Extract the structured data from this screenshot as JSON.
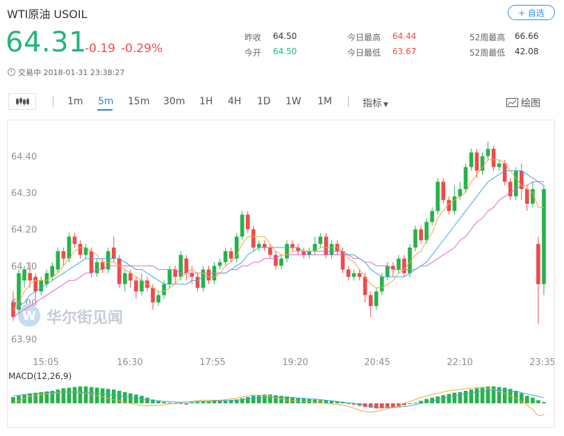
{
  "header": {
    "title": "WTI原油  USOIL",
    "add_button": "+ 自选",
    "price": "64.31",
    "change": "-0.19",
    "change_pct": "-0.29%",
    "status": "交易中 2018-01-31 23:38:27"
  },
  "stats": [
    {
      "label": "昨收",
      "value": "64.50",
      "color": "#333333"
    },
    {
      "label": "今开",
      "value": "64.50",
      "color": "#21b67a"
    },
    {
      "label": "今日最高",
      "value": "64.44",
      "color": "#f04a4a"
    },
    {
      "label": "今日最低",
      "value": "63.67",
      "color": "#f04a4a"
    },
    {
      "label": "52周最高",
      "value": "66.66",
      "color": "#333333"
    },
    {
      "label": "52周最低",
      "value": "42.08",
      "color": "#333333"
    }
  ],
  "toolbar": {
    "intervals": [
      "1m",
      "5m",
      "15m",
      "30m",
      "1H",
      "4H",
      "1D",
      "1W",
      "1M"
    ],
    "active": "5m",
    "indicators": "指标",
    "draw": "绘图"
  },
  "watermark": "华尔街见闻",
  "colors": {
    "up": "#26b34a",
    "down": "#f04a4a",
    "accent": "#2f7fd8",
    "ma5": "#f0a53c",
    "ma10": "#3aa7e0",
    "ma20": "#e063d8"
  },
  "chart_data": {
    "type": "candlestick",
    "y_ticks": [
      "64.40",
      "64.30",
      "64.20",
      "64.10",
      "64.00",
      "63.90"
    ],
    "ylim": [
      63.88,
      64.46
    ],
    "x_labels": [
      "15:05",
      "16:30",
      "17:55",
      "19:20",
      "20:45",
      "22:10",
      "23:35"
    ],
    "macd_label": "MACD(12,26,9)",
    "candles": [
      [
        64.0,
        63.96,
        64.03,
        63.95
      ],
      [
        63.98,
        64.08,
        64.09,
        63.97
      ],
      [
        64.06,
        64.09,
        64.1,
        64.04
      ],
      [
        64.08,
        64.06,
        64.11,
        64.04
      ],
      [
        64.07,
        64.03,
        64.08,
        64.01
      ],
      [
        64.03,
        64.06,
        64.07,
        64.02
      ],
      [
        64.05,
        64.08,
        64.09,
        64.04
      ],
      [
        64.07,
        64.1,
        64.11,
        64.06
      ],
      [
        64.09,
        64.14,
        64.15,
        64.08
      ],
      [
        64.14,
        64.12,
        64.15,
        64.1
      ],
      [
        64.12,
        64.18,
        64.19,
        64.11
      ],
      [
        64.18,
        64.16,
        64.19,
        64.15
      ],
      [
        64.16,
        64.13,
        64.17,
        64.12
      ],
      [
        64.13,
        64.15,
        64.16,
        64.12
      ],
      [
        64.14,
        64.08,
        64.15,
        64.07
      ],
      [
        64.08,
        64.11,
        64.12,
        64.07
      ],
      [
        64.11,
        64.09,
        64.12,
        64.08
      ],
      [
        64.09,
        64.14,
        64.15,
        64.08
      ],
      [
        64.15,
        64.12,
        64.18,
        64.11
      ],
      [
        64.12,
        64.05,
        64.13,
        64.04
      ],
      [
        64.05,
        64.08,
        64.09,
        64.03
      ],
      [
        64.08,
        64.06,
        64.09,
        64.04
      ],
      [
        64.06,
        64.03,
        64.07,
        64.01
      ],
      [
        64.03,
        64.06,
        64.08,
        64.02
      ],
      [
        64.06,
        64.04,
        64.07,
        64.03
      ],
      [
        64.04,
        64.0,
        64.05,
        63.98
      ],
      [
        64.0,
        64.02,
        64.03,
        63.99
      ],
      [
        64.02,
        64.05,
        64.06,
        64.01
      ],
      [
        64.05,
        64.09,
        64.1,
        64.04
      ],
      [
        64.09,
        64.07,
        64.1,
        64.05
      ],
      [
        64.07,
        64.13,
        64.14,
        64.06
      ],
      [
        64.12,
        64.08,
        64.13,
        64.06
      ],
      [
        64.08,
        64.07,
        64.1,
        64.05
      ],
      [
        64.07,
        64.04,
        64.08,
        64.03
      ],
      [
        64.04,
        64.09,
        64.1,
        64.03
      ],
      [
        64.09,
        64.06,
        64.1,
        64.05
      ],
      [
        64.06,
        64.1,
        64.11,
        64.05
      ],
      [
        64.1,
        64.11,
        64.12,
        64.09
      ],
      [
        64.11,
        64.14,
        64.15,
        64.1
      ],
      [
        64.14,
        64.12,
        64.15,
        64.11
      ],
      [
        64.12,
        64.18,
        64.19,
        64.11
      ],
      [
        64.18,
        64.24,
        64.25,
        64.17
      ],
      [
        64.24,
        64.2,
        64.25,
        64.19
      ],
      [
        64.2,
        64.15,
        64.21,
        64.14
      ],
      [
        64.15,
        64.16,
        64.17,
        64.14
      ],
      [
        64.16,
        64.15,
        64.17,
        64.14
      ],
      [
        64.15,
        64.13,
        64.16,
        64.12
      ],
      [
        64.13,
        64.1,
        64.14,
        64.09
      ],
      [
        64.1,
        64.12,
        64.13,
        64.09
      ],
      [
        64.12,
        64.16,
        64.17,
        64.11
      ],
      [
        64.16,
        64.15,
        64.17,
        64.14
      ],
      [
        64.15,
        64.14,
        64.16,
        64.13
      ],
      [
        64.14,
        64.13,
        64.15,
        64.12
      ],
      [
        64.13,
        64.14,
        64.15,
        64.12
      ],
      [
        64.14,
        64.16,
        64.18,
        64.13
      ],
      [
        64.16,
        64.18,
        64.19,
        64.15
      ],
      [
        64.18,
        64.13,
        64.19,
        64.12
      ],
      [
        64.13,
        64.16,
        64.17,
        64.12
      ],
      [
        64.16,
        64.14,
        64.17,
        64.13
      ],
      [
        64.14,
        64.09,
        64.15,
        64.08
      ],
      [
        64.09,
        64.07,
        64.1,
        64.06
      ],
      [
        64.07,
        64.08,
        64.09,
        64.06
      ],
      [
        64.08,
        64.07,
        64.09,
        64.06
      ],
      [
        64.07,
        64.02,
        64.08,
        64.0
      ],
      [
        64.02,
        63.99,
        64.03,
        63.96
      ],
      [
        63.99,
        64.03,
        64.04,
        63.98
      ],
      [
        64.03,
        64.07,
        64.08,
        64.02
      ],
      [
        64.07,
        64.1,
        64.11,
        64.06
      ],
      [
        64.1,
        64.09,
        64.11,
        64.07
      ],
      [
        64.09,
        64.12,
        64.13,
        64.08
      ],
      [
        64.12,
        64.08,
        64.13,
        64.07
      ],
      [
        64.08,
        64.15,
        64.16,
        64.07
      ],
      [
        64.15,
        64.2,
        64.21,
        64.14
      ],
      [
        64.2,
        64.17,
        64.21,
        64.16
      ],
      [
        64.17,
        64.22,
        64.23,
        64.16
      ],
      [
        64.22,
        64.25,
        64.26,
        64.21
      ],
      [
        64.25,
        64.33,
        64.34,
        64.24
      ],
      [
        64.33,
        64.28,
        64.34,
        64.27
      ],
      [
        64.28,
        64.25,
        64.29,
        64.24
      ],
      [
        64.25,
        64.29,
        64.32,
        64.24
      ],
      [
        64.29,
        64.31,
        64.33,
        64.28
      ],
      [
        64.31,
        64.37,
        64.38,
        64.3
      ],
      [
        64.37,
        64.41,
        64.42,
        64.36
      ],
      [
        64.41,
        64.36,
        64.42,
        64.34
      ],
      [
        64.36,
        64.4,
        64.41,
        64.35
      ],
      [
        64.4,
        64.42,
        64.44,
        64.39
      ],
      [
        64.42,
        64.37,
        64.43,
        64.36
      ],
      [
        64.37,
        64.38,
        64.39,
        64.36
      ],
      [
        64.38,
        64.33,
        64.39,
        64.32
      ],
      [
        64.33,
        64.29,
        64.34,
        64.28
      ],
      [
        64.29,
        64.36,
        64.37,
        64.28
      ],
      [
        64.36,
        64.31,
        64.38,
        64.28
      ],
      [
        64.31,
        64.27,
        64.32,
        64.25
      ],
      [
        64.27,
        64.31,
        64.33,
        64.26
      ],
      [
        64.16,
        64.05,
        64.18,
        63.94
      ],
      [
        64.05,
        64.31,
        64.32,
        64.02
      ]
    ],
    "ma5": [
      63.98,
      64.0,
      64.03,
      64.05,
      64.06,
      64.06,
      64.06,
      64.07,
      64.08,
      64.1,
      64.12,
      64.14,
      64.15,
      64.15,
      64.14,
      64.13,
      64.11,
      64.11,
      64.11,
      64.1,
      64.09,
      64.08,
      64.07,
      64.06,
      64.05,
      64.04,
      64.03,
      64.03,
      64.04,
      64.05,
      64.07,
      64.08,
      64.09,
      64.08,
      64.08,
      64.07,
      64.07,
      64.08,
      64.1,
      64.11,
      64.13,
      64.16,
      64.18,
      64.18,
      64.18,
      64.18,
      64.16,
      64.14,
      64.13,
      64.13,
      64.14,
      64.14,
      64.14,
      64.14,
      64.14,
      64.15,
      64.15,
      64.15,
      64.15,
      64.14,
      64.12,
      64.11,
      64.09,
      64.07,
      64.05,
      64.04,
      64.04,
      64.05,
      64.06,
      64.08,
      64.09,
      64.11,
      64.13,
      64.14,
      64.17,
      64.19,
      64.23,
      64.25,
      64.27,
      64.28,
      64.29,
      64.3,
      64.33,
      64.35,
      64.37,
      64.39,
      64.39,
      64.39,
      64.38,
      64.36,
      64.34,
      64.32,
      64.31,
      64.3,
      64.26,
      64.26
    ],
    "ma10": [
      63.98,
      63.99,
      64.0,
      64.02,
      64.03,
      64.04,
      64.05,
      64.06,
      64.07,
      64.08,
      64.09,
      64.1,
      64.11,
      64.12,
      64.12,
      64.12,
      64.12,
      64.12,
      64.12,
      64.12,
      64.11,
      64.1,
      64.09,
      64.09,
      64.08,
      64.07,
      64.06,
      64.05,
      64.05,
      64.05,
      64.05,
      64.05,
      64.06,
      64.06,
      64.07,
      64.07,
      64.07,
      64.08,
      64.08,
      64.09,
      64.1,
      64.11,
      64.13,
      64.14,
      64.15,
      64.15,
      64.15,
      64.15,
      64.15,
      64.15,
      64.15,
      64.15,
      64.14,
      64.14,
      64.14,
      64.14,
      64.14,
      64.14,
      64.14,
      64.14,
      64.13,
      64.13,
      64.12,
      64.11,
      64.09,
      64.08,
      64.07,
      64.07,
      64.07,
      64.07,
      64.07,
      64.08,
      64.09,
      64.1,
      64.11,
      64.13,
      64.15,
      64.17,
      64.19,
      64.21,
      64.23,
      64.25,
      64.27,
      64.29,
      64.31,
      64.33,
      64.34,
      64.35,
      64.36,
      64.36,
      64.36,
      64.36,
      64.35,
      64.34,
      64.33,
      64.32
    ],
    "ma20": [
      63.96,
      63.97,
      63.98,
      63.99,
      64.0,
      64.01,
      64.02,
      64.03,
      64.04,
      64.05,
      64.06,
      64.06,
      64.07,
      64.08,
      64.08,
      64.09,
      64.09,
      64.1,
      64.1,
      64.1,
      64.1,
      64.1,
      64.1,
      64.1,
      64.1,
      64.1,
      64.09,
      64.09,
      64.09,
      64.09,
      64.08,
      64.08,
      64.08,
      64.08,
      64.08,
      64.08,
      64.08,
      64.08,
      64.08,
      64.09,
      64.09,
      64.1,
      64.1,
      64.11,
      64.11,
      64.12,
      64.12,
      64.12,
      64.13,
      64.13,
      64.13,
      64.13,
      64.13,
      64.13,
      64.13,
      64.13,
      64.13,
      64.13,
      64.13,
      64.13,
      64.13,
      64.12,
      64.12,
      64.11,
      64.11,
      64.1,
      64.1,
      64.1,
      64.09,
      64.09,
      64.09,
      64.09,
      64.09,
      64.1,
      64.1,
      64.11,
      64.12,
      64.13,
      64.14,
      64.15,
      64.17,
      64.18,
      64.2,
      64.22,
      64.23,
      64.25,
      64.26,
      64.28,
      64.29,
      64.3,
      64.31,
      64.32,
      64.32,
      64.33,
      64.33,
      64.33
    ],
    "macd_hist": [
      0.01,
      0.012,
      0.014,
      0.016,
      0.017,
      0.018,
      0.019,
      0.02,
      0.022,
      0.024,
      0.025,
      0.026,
      0.027,
      0.027,
      0.026,
      0.025,
      0.024,
      0.023,
      0.022,
      0.02,
      0.018,
      0.016,
      0.014,
      0.012,
      0.009,
      0.006,
      0.004,
      0.002,
      0.001,
      0.0,
      -0.001,
      -0.002,
      0.001,
      0.002,
      0.003,
      0.003,
      0.004,
      0.004,
      0.005,
      0.005,
      0.006,
      0.008,
      0.01,
      0.012,
      0.013,
      0.014,
      0.014,
      0.013,
      0.012,
      0.011,
      0.01,
      0.009,
      0.008,
      0.007,
      0.006,
      0.005,
      0.005,
      0.004,
      0.003,
      0.002,
      0.0,
      -0.002,
      -0.004,
      -0.006,
      -0.007,
      -0.008,
      -0.008,
      -0.007,
      -0.006,
      -0.005,
      -0.003,
      -0.001,
      0.001,
      0.004,
      0.007,
      0.009,
      0.011,
      0.013,
      0.015,
      0.017,
      0.018,
      0.02,
      0.022,
      0.024,
      0.026,
      0.027,
      0.027,
      0.026,
      0.025,
      0.023,
      0.02,
      0.016,
      0.012,
      0.009,
      0.005,
      0.002
    ],
    "macd_dif": [
      0.0,
      0.004,
      0.008,
      0.011,
      0.013,
      0.014,
      0.015,
      0.016,
      0.017,
      0.018,
      0.018,
      0.018,
      0.017,
      0.016,
      0.014,
      0.012,
      0.01,
      0.008,
      0.006,
      0.004,
      0.002,
      0.0,
      -0.002,
      -0.003,
      -0.004,
      -0.004,
      -0.003,
      -0.002,
      -0.001,
      0.0,
      0.001,
      0.002,
      0.003,
      0.004,
      0.005,
      0.005,
      0.005,
      0.005,
      0.006,
      0.007,
      0.008,
      0.01,
      0.012,
      0.013,
      0.013,
      0.012,
      0.011,
      0.009,
      0.007,
      0.005,
      0.004,
      0.003,
      0.003,
      0.003,
      0.002,
      0.001,
      0.0,
      -0.001,
      -0.002,
      -0.003,
      -0.005,
      -0.008,
      -0.011,
      -0.013,
      -0.014,
      -0.013,
      -0.011,
      -0.009,
      -0.006,
      -0.003,
      0.0,
      0.003,
      0.006,
      0.009,
      0.012,
      0.014,
      0.016,
      0.018,
      0.02,
      0.021,
      0.022,
      0.023,
      0.024,
      0.025,
      0.025,
      0.024,
      0.022,
      0.019,
      0.016,
      0.012,
      0.008,
      0.003,
      -0.003,
      -0.01,
      -0.02,
      -0.018
    ],
    "macd_dea": [
      0.012,
      0.013,
      0.014,
      0.015,
      0.016,
      0.016,
      0.017,
      0.017,
      0.018,
      0.018,
      0.018,
      0.018,
      0.018,
      0.017,
      0.017,
      0.016,
      0.015,
      0.014,
      0.013,
      0.012,
      0.011,
      0.01,
      0.008,
      0.007,
      0.006,
      0.005,
      0.004,
      0.003,
      0.003,
      0.002,
      0.002,
      0.002,
      0.002,
      0.003,
      0.003,
      0.003,
      0.004,
      0.004,
      0.004,
      0.005,
      0.005,
      0.006,
      0.007,
      0.008,
      0.009,
      0.009,
      0.01,
      0.01,
      0.01,
      0.009,
      0.009,
      0.008,
      0.008,
      0.007,
      0.007,
      0.006,
      0.005,
      0.004,
      0.003,
      0.002,
      0.001,
      0.0,
      -0.002,
      -0.003,
      -0.005,
      -0.006,
      -0.007,
      -0.007,
      -0.007,
      -0.006,
      -0.005,
      -0.004,
      -0.002,
      0.0,
      0.002,
      0.004,
      0.006,
      0.008,
      0.01,
      0.012,
      0.014,
      0.015,
      0.017,
      0.018,
      0.019,
      0.02,
      0.021,
      0.021,
      0.021,
      0.02,
      0.019,
      0.017,
      0.015,
      0.013,
      0.011,
      0.009
    ]
  }
}
